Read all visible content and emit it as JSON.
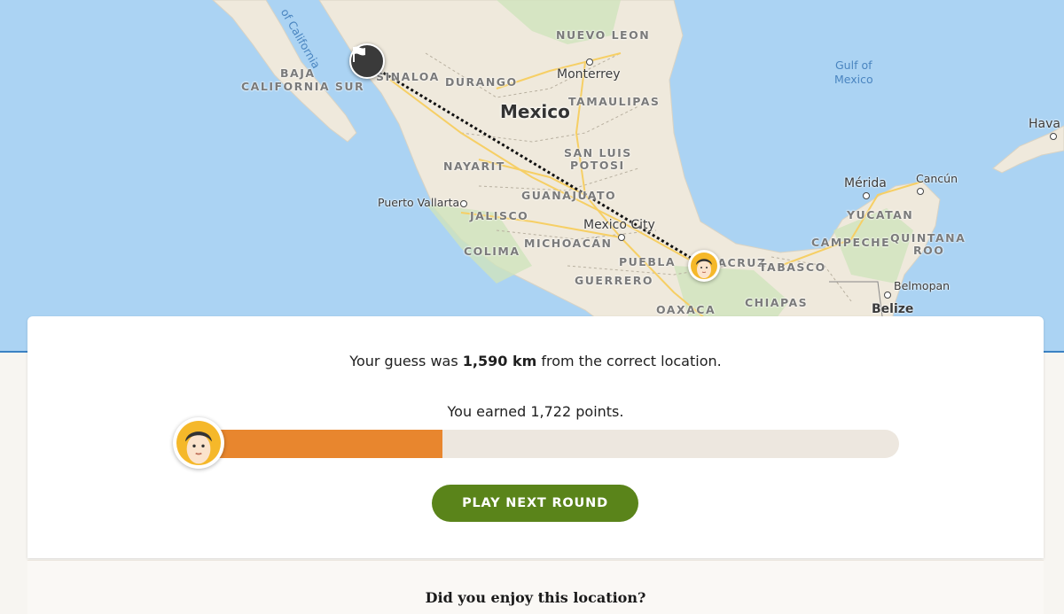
{
  "map": {
    "labels": {
      "gulf_california": "of California",
      "baja_1": "BAJA",
      "baja_2": "CALIFORNIA SUR",
      "sinaloa": "SINALOA",
      "durango": "DURANGO",
      "nuevo_leon": "NUEVO LEON",
      "monterrey": "Monterrey",
      "tamaulipas": "TAMAULIPAS",
      "mexico": "Mexico",
      "nayarit": "NAYARIT",
      "san_luis_1": "SAN LUIS",
      "san_luis_2": "POTOSI",
      "guanajuato": "GUANAJUATO",
      "puerto_vallarta": "Puerto Vallarta",
      "jalisco": "JALISCO",
      "mexico_city": "Mexico City",
      "michoacan": "MICHOACÁN",
      "colima": "COLIMA",
      "puebla": "PUEBLA",
      "veracruz": "VERACRUZ",
      "guerrero": "GUERRERO",
      "oaxaca": "OAXACA",
      "tabasco": "TABASCO",
      "chiapas": "CHIAPAS",
      "gulf_1": "Gulf of",
      "gulf_2": "Mexico",
      "havana": "Hava",
      "merida": "Mérida",
      "cancun": "Cancún",
      "yucatan": "YUCATAN",
      "campeche": "CAMPECHE",
      "quintana_1": "QUINTANA",
      "quintana_2": "ROO",
      "belmopan": "Belmopan",
      "belize": "Belize"
    },
    "colors": {
      "water": "#abd3f3",
      "land": "#efe9dc",
      "highway": "#f6cf65"
    },
    "markers": {
      "correct": "flag-icon",
      "guess": "player-avatar"
    }
  },
  "result": {
    "distance_prefix": "Your guess was",
    "distance_value": "1,590 km",
    "distance_suffix": "from the correct location.",
    "points_text": "You earned 1,722 points.",
    "points": 1722,
    "max_points": 5000,
    "progress_fraction": 0.344,
    "next_button": "PLAY NEXT ROUND",
    "colors": {
      "progress": "#e8862e",
      "button": "#5a841a"
    }
  },
  "feedback": {
    "title": "Did you enjoy this location?"
  }
}
